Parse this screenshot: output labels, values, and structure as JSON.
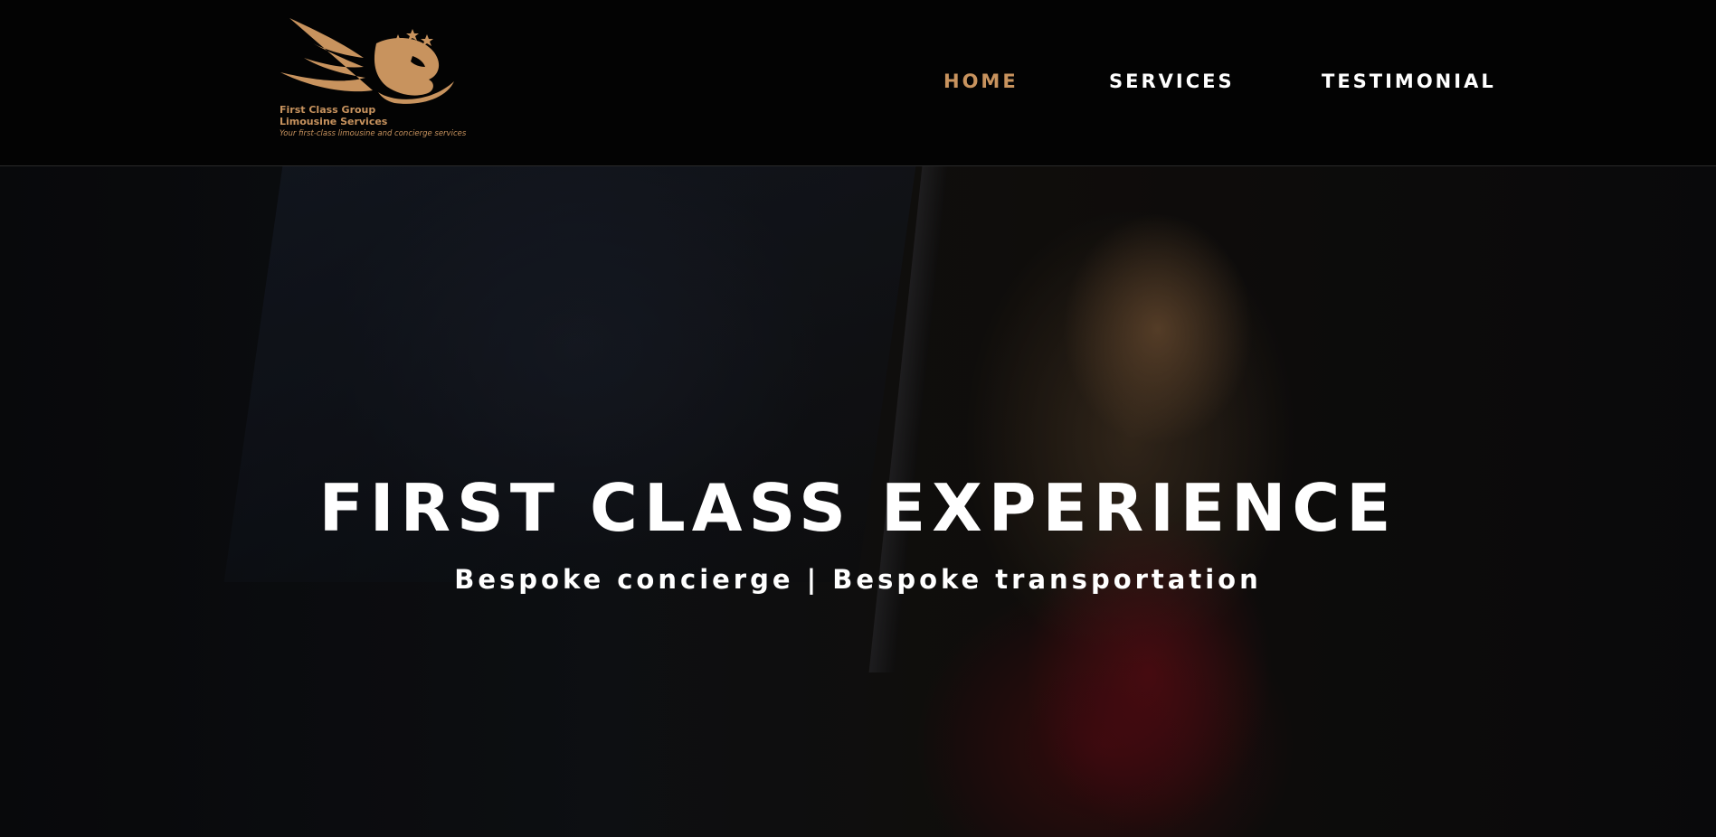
{
  "brand": {
    "name_line1": "First Class Group",
    "name_line2": "Limousine Services",
    "tagline": "Your first-class limousine and concierge services",
    "accent_color": "#c8935e",
    "logo_icon": "winged-lion-icon"
  },
  "nav": {
    "items": [
      {
        "label": "HOME",
        "active": true
      },
      {
        "label": "SERVICES",
        "active": false
      },
      {
        "label": "TESTIMONIAL",
        "active": false
      }
    ]
  },
  "hero": {
    "title": "FIRST CLASS EXPERIENCE",
    "subtitle": "Bespoke concierge | Bespoke transportation"
  }
}
